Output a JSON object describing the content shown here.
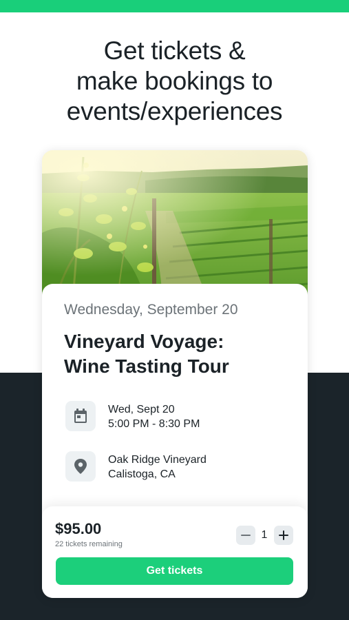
{
  "headline": {
    "line1": "Get tickets &",
    "line2": "make bookings to",
    "line3": "events/experiences"
  },
  "event": {
    "date_label": "Wednesday, September 20",
    "title_line1": "Vineyard Voyage:",
    "title_line2": "Wine Tasting Tour",
    "when_line1": "Wed, Sept 20",
    "when_line2": "5:00 PM - 8:30 PM",
    "where_line1": "Oak Ridge Vineyard",
    "where_line2": "Calistoga, CA"
  },
  "purchase": {
    "price": "$95.00",
    "remaining": "22 tickets remaining",
    "quantity": "1",
    "cta_label": "Get tickets"
  },
  "icons": {
    "calendar": "calendar-icon",
    "location": "map-pin-icon",
    "minus": "minus-icon",
    "plus": "plus-icon"
  },
  "colors": {
    "accent": "#19cf7a",
    "dark_background": "#1b242a",
    "text": "#1b2227",
    "muted_text": "#6c7378"
  }
}
